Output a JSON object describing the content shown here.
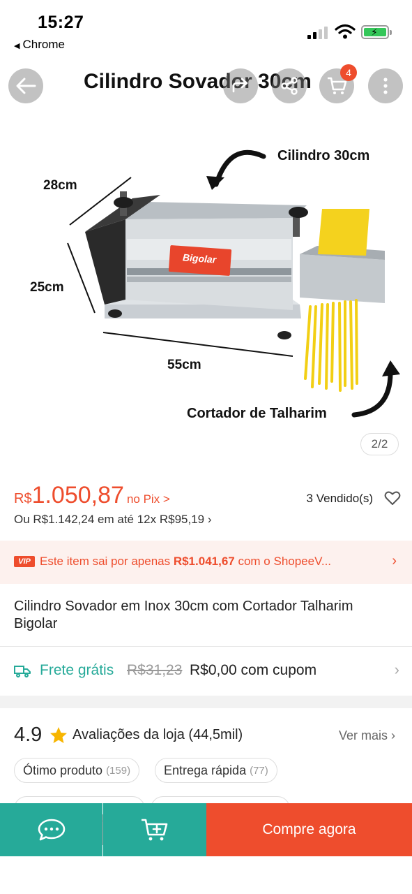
{
  "status_bar": {
    "time": "15:27",
    "back_app": "Chrome"
  },
  "header": {
    "title": "Cilindro Sovador 30cm",
    "cart_count": "4"
  },
  "image": {
    "labels": {
      "top": "Cilindro 30cm",
      "width": "28cm",
      "height": "25cm",
      "length": "55cm",
      "bottom": "Cortador de Talharim",
      "brand": "Bigolar"
    },
    "counter": "2/2"
  },
  "price": {
    "currency": "R$",
    "value": "1.050,87",
    "pix": "no Pix >",
    "sold": "3 Vendido(s)",
    "installments": "Ou R$1.142,24 em até 12x R$95,19"
  },
  "vip": {
    "badge": "VIP",
    "text_before": "Este item sai por apenas ",
    "text_price": "R$1.041,67",
    "text_after": " com o ShopeeV..."
  },
  "product": {
    "name": "Cilindro Sovador em Inox 30cm com Cortador Talharim Bigolar"
  },
  "shipping": {
    "label": "Frete grátis",
    "old_price": "R$31,23",
    "new_price": "R$0,00 com cupom"
  },
  "store_rating": {
    "score": "4.9",
    "label": "Avaliações da loja",
    "count": "(44,5mil)",
    "see_more": "Ver mais",
    "tags": [
      {
        "label": "Ótimo produto",
        "count": "(159)"
      },
      {
        "label": "Entrega rápida",
        "count": "(77)"
      }
    ]
  },
  "bottom_bar": {
    "buy_now": "Compre agora"
  },
  "colors": {
    "brand": "#ee4d2d",
    "teal": "#26aa99"
  }
}
